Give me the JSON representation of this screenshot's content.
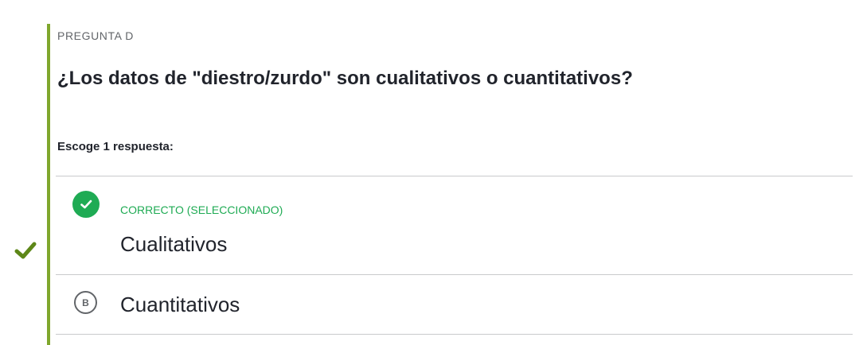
{
  "question": {
    "label": "PREGUNTA D",
    "text": "¿Los datos de \"diestro/zurdo\" son cualitativos o cuantitativos?",
    "instruction": "Escoge 1 respuesta:"
  },
  "choices": [
    {
      "status": "CORRECTO (SELECCIONADO)",
      "text": "Cualitativos",
      "icon": "check-circle-icon",
      "selected": true,
      "correct": true
    },
    {
      "letter": "B",
      "text": "Cuantitativos",
      "selected": false
    }
  ],
  "colors": {
    "accent_bar": "#7fa72d",
    "correct": "#1fab54",
    "outer_check": "#5d8718",
    "text": "#21242c",
    "muted": "#626569",
    "divider": "#c9cacc"
  }
}
